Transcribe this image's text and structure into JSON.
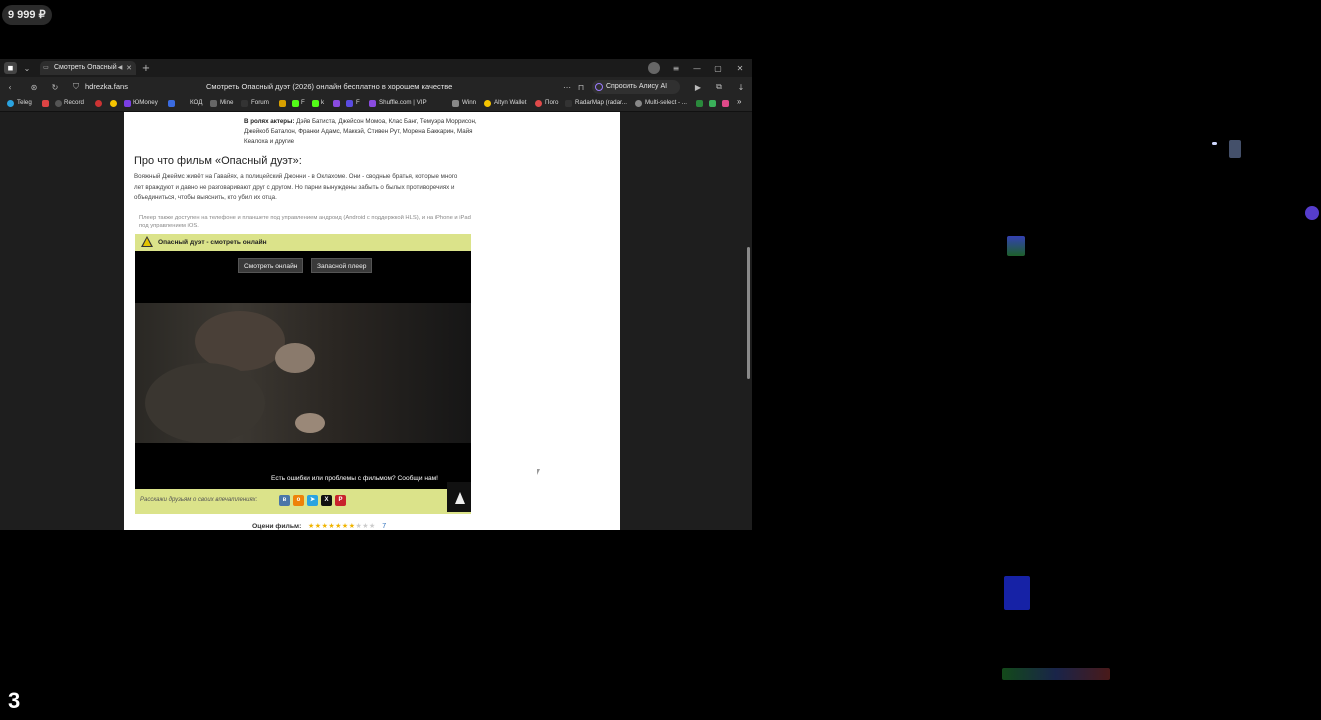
{
  "desktop": {
    "balance_badge": "9 999 ₽",
    "corner_counter": "3"
  },
  "browser": {
    "tab": {
      "title": "Смотреть Опасный"
    },
    "address": {
      "url": "hdrezka.fans",
      "page_title": "Смотреть Опасный дуэт (2026) онлайн бесплатно в хорошем качестве"
    },
    "alisa_button": "Спросить Алису AI",
    "bookmarks": [
      "Teleg",
      "Record",
      "ЮMoney",
      "КОД",
      "Mine",
      "Forum",
      "F",
      "k",
      "F",
      "Shuffle.com | VIP",
      "Winn",
      "Altyn Wallet",
      "Пого",
      "RadarMap (radar...",
      "Multi-select - ..."
    ],
    "bookmarks_more": "»"
  },
  "page": {
    "cast_label": "В ролях актеры:",
    "cast_text": "Дэйв Батиста, Джейсон Момоа, Клаc Банг, Темуэра Моррисон, Джейкоб Баталон, Франки Адамс, Маккэй, Стивен Рут, Морена Баккарин, Майя Кеалоха и другие",
    "about_heading": "Про что фильм «Опасный дуэт»:",
    "description": "Вояжный Джеймс живёт на Гавайях, а полицейский Джонни - в Оклахоме. Они - сводные братья, которые много лет враждуют и давно не разговаривают друг с другом. Но парни вынуждены забыть о былых противоречиях и объединиться, чтобы выяснить, кто убил их отца.",
    "player_note": "Плеер также доступен на телефоне и планшете под управлением андроид (Android с поддержкой HLS), и на iPhone и iPad под управлением iOS.",
    "watch_bar": "Опасный дуэт - смотреть онлайн",
    "watch_button": "Смотреть онлайн",
    "backup_button": "Запасной плеер",
    "report_text": "Есть ошибки или проблемы с фильмом? Сообщи нам!",
    "share_text": "Расскажи друзьям о своих впечатлениях:",
    "share_icons": [
      "vk-icon",
      "ok-icon",
      "telegram-icon",
      "x-icon",
      "pinterest-icon"
    ],
    "rating_label": "Оцени фильм:",
    "rating_stars_filled": 7,
    "rating_stars_total": 10,
    "rating_value": "7"
  },
  "colors": {
    "accent_bar": "#dbe38a",
    "page_bg": "#ffffff",
    "browser_bg": "#1f1f1f"
  }
}
